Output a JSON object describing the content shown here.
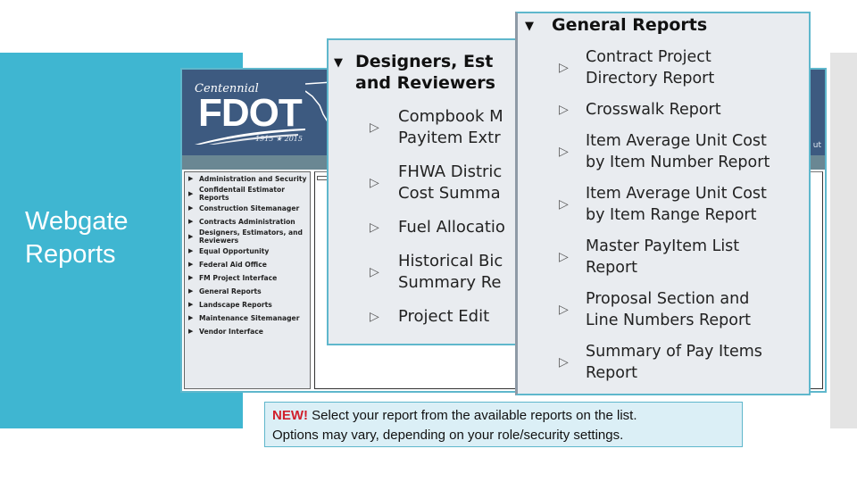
{
  "slide": {
    "title": "Webgate Reports",
    "colors": {
      "accent": "#3fb6d1",
      "panel_border": "#5fb7cc",
      "panel_bg": "#e9ecf0",
      "new_badge": "#d11f2b"
    }
  },
  "fdot_page": {
    "logo": {
      "top_text": "Centennial",
      "main_text": "FDOT",
      "years": "1915 ★ 2015"
    },
    "header_fragment": "ut",
    "nav_items": [
      {
        "label": "Administration and Security",
        "icon": "right-triangle-icon"
      },
      {
        "label": "Confidentail Estimator Reports",
        "icon": "right-triangle-icon"
      },
      {
        "label": "Construction Sitemanager",
        "icon": "right-triangle-icon"
      },
      {
        "label": "Contracts Administration",
        "icon": "right-triangle-icon"
      },
      {
        "label": "Designers, Estimators, and Reviewers",
        "icon": "right-triangle-icon"
      },
      {
        "label": "Equal Opportunity",
        "icon": "right-triangle-icon"
      },
      {
        "label": "Federal Aid Office",
        "icon": "right-triangle-icon"
      },
      {
        "label": "FM Project Interface",
        "icon": "right-triangle-icon"
      },
      {
        "label": "General Reports",
        "icon": "right-triangle-icon"
      },
      {
        "label": "Landscape Reports",
        "icon": "right-triangle-icon"
      },
      {
        "label": "Maintenance Sitemanager",
        "icon": "right-triangle-icon"
      },
      {
        "label": "Vendor Interface",
        "icon": "right-triangle-icon"
      }
    ]
  },
  "designers_panel": {
    "heading_line1": "Designers, Est",
    "heading_line2": "and Reviewers",
    "heading_icon": "down-caret-icon",
    "items": [
      {
        "line1": "Compbook M",
        "line2": "Payitem Extr"
      },
      {
        "line1": "FHWA Distric",
        "line2": "Cost Summa"
      },
      {
        "line1": "Fuel Allocatio",
        "line2": ""
      },
      {
        "line1": "Historical Bic",
        "line2": "Summary Re"
      },
      {
        "line1": "Project Edit",
        "line2": ""
      }
    ]
  },
  "general_panel": {
    "heading": "General Reports",
    "heading_icon": "down-caret-icon",
    "items": [
      {
        "line1": "Contract Project",
        "line2": "Directory Report"
      },
      {
        "line1": "Crosswalk Report",
        "line2": ""
      },
      {
        "line1": "Item Average Unit Cost",
        "line2": "by Item Number Report"
      },
      {
        "line1": "Item Average Unit Cost",
        "line2": "by Item Range Report"
      },
      {
        "line1": "Master PayItem List",
        "line2": "Report"
      },
      {
        "line1": "Proposal Section and",
        "line2": "Line Numbers Report"
      },
      {
        "line1": "Summary of Pay Items",
        "line2": "Report"
      }
    ]
  },
  "note": {
    "badge": "NEW!",
    "line1": " Select your report from the available reports on the list.",
    "line2": "Options may vary, depending on your role/security settings."
  }
}
